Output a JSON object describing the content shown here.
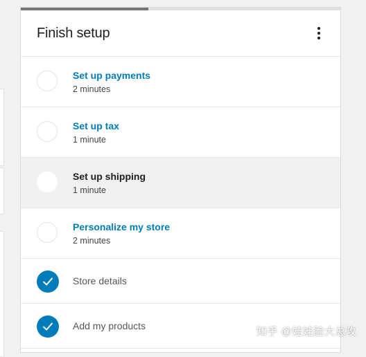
{
  "card": {
    "title": "Finish setup",
    "progress": 0.4
  },
  "tasks": [
    {
      "label": "Set up payments",
      "time": "2 minutes",
      "completed": false
    },
    {
      "label": "Set up tax",
      "time": "1 minute",
      "completed": false
    },
    {
      "label": "Set up shipping",
      "time": "1 minute",
      "completed": false,
      "hovered": true
    },
    {
      "label": "Personalize my store",
      "time": "2 minutes",
      "completed": false
    },
    {
      "label": "Store details",
      "completed": true
    },
    {
      "label": "Add my products",
      "completed": true
    }
  ],
  "watermark": "知乎 @娃娃脸大总攻",
  "colors": {
    "accent": "#007cba",
    "progress": "#757575",
    "text": "#1e1e1e"
  },
  "icons": {
    "menu": "more-vertical-icon",
    "check": "checkmark-icon"
  }
}
